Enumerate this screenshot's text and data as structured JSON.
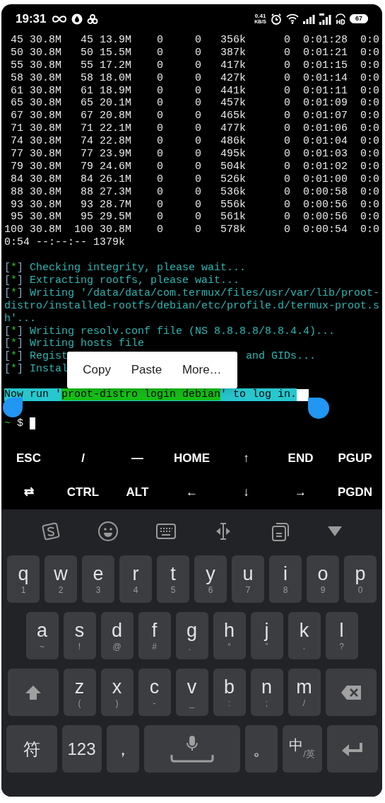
{
  "status_bar": {
    "time": "19:31",
    "net_speed": "0.41",
    "net_speed_unit": "KB/S",
    "battery": "67"
  },
  "terminal": {
    "progress_lines": [
      " 45 30.8M   45 13.9M    0     0   356k      0  0:01:28  0:0",
      " 50 30.8M   50 15.5M    0     0   387k      0  0:01:21  0:0",
      " 55 30.8M   55 17.2M    0     0   417k      0  0:01:15  0:0",
      " 58 30.8M   58 18.0M    0     0   427k      0  0:01:14  0:0",
      " 61 30.8M   61 18.9M    0     0   441k      0  0:01:11  0:0",
      " 65 30.8M   65 20.1M    0     0   457k      0  0:01:09  0:0",
      " 67 30.8M   67 20.8M    0     0   465k      0  0:01:07  0:0",
      " 71 30.8M   71 22.1M    0     0   477k      0  0:01:06  0:0",
      " 74 30.8M   74 22.8M    0     0   486k      0  0:01:04  0:0",
      " 77 30.8M   77 23.9M    0     0   495k      0  0:01:03  0:0",
      " 79 30.8M   79 24.6M    0     0   504k      0  0:01:02  0:0",
      " 84 30.8M   84 26.1M    0     0   526k      0  0:01:00  0:0",
      " 88 30.8M   88 27.3M    0     0   536k      0  0:00:58  0:0",
      " 93 30.8M   93 28.7M    0     0   556k      0  0:00:56  0:0",
      " 95 30.8M   95 29.5M    0     0   561k      0  0:00:56  0:0",
      "100 30.8M  100 30.8M    0     0   578k      0  0:00:54  0:0"
    ],
    "summary_line": "0:54 --:--:-- 1379k",
    "messages": [
      {
        "marker": {
          "open": "[",
          "star": "*",
          "close": "]"
        },
        "parts": [
          "Checking integrity, please wait..."
        ]
      },
      {
        "marker": {
          "open": "[",
          "star": "*",
          "close": "]"
        },
        "parts": [
          "Extracting rootfs, please wait..."
        ]
      },
      {
        "marker": {
          "open": "[",
          "star": "*",
          "close": "]"
        },
        "parts": [
          "Writing '/data/data/com.termux/files/usr/var/lib/proot-distro/installed-rootfs/debian/etc/profile.d/termux-proot.sh'..."
        ]
      },
      {
        "marker": {
          "open": "[",
          "star": "*",
          "close": "]"
        },
        "parts": [
          "Writing resolv.conf file (NS 8.8.8.8/8.8.4.4)..."
        ]
      },
      {
        "marker": {
          "open": "[",
          "star": "*",
          "close": "]"
        },
        "parts": [
          "Writing hosts file"
        ]
      },
      {
        "marker": {
          "open": "[",
          "star": "*",
          "close": "]"
        },
        "parts": [
          "Regist",
          "and GIDs..."
        ]
      },
      {
        "marker": {
          "open": "[",
          "star": "*",
          "close": "]"
        },
        "parts": [
          "Instal"
        ]
      }
    ],
    "selected_line": {
      "before": "Now run '",
      "command": "proot-distro login debian",
      "after": "' to log in."
    },
    "prompt": {
      "dir": "~",
      "sign": "$"
    }
  },
  "context_menu": [
    "Copy",
    "Paste",
    "More…"
  ],
  "extra_keys": [
    [
      "ESC",
      "/",
      "—",
      "HOME",
      "↑",
      "END",
      "PGUP"
    ],
    [
      "⇄",
      "CTRL",
      "ALT",
      "←",
      "↓",
      "→",
      "PGDN"
    ]
  ],
  "keyboard": {
    "letter_rows": [
      [
        {
          "kind": "letter",
          "main": "q",
          "sub": "1"
        },
        {
          "kind": "letter",
          "main": "w",
          "sub": "2"
        },
        {
          "kind": "letter",
          "main": "e",
          "sub": "3"
        },
        {
          "kind": "letter",
          "main": "r",
          "sub": "4"
        },
        {
          "kind": "letter",
          "main": "t",
          "sub": "5"
        },
        {
          "kind": "letter",
          "main": "y",
          "sub": "6"
        },
        {
          "kind": "letter",
          "main": "u",
          "sub": "7"
        },
        {
          "kind": "letter",
          "main": "i",
          "sub": "8"
        },
        {
          "kind": "letter",
          "main": "o",
          "sub": "9"
        },
        {
          "kind": "letter",
          "main": "p",
          "sub": "0"
        }
      ],
      [
        {
          "kind": "letter",
          "main": "a",
          "sub": "~"
        },
        {
          "kind": "letter",
          "main": "s",
          "sub": "!"
        },
        {
          "kind": "letter",
          "main": "d",
          "sub": "@"
        },
        {
          "kind": "letter",
          "main": "f",
          "sub": "#"
        },
        {
          "kind": "letter",
          "main": "g",
          "sub": "、"
        },
        {
          "kind": "letter",
          "main": "h",
          "sub": "“"
        },
        {
          "kind": "letter",
          "main": "j",
          "sub": "”"
        },
        {
          "kind": "letter",
          "main": "k",
          "sub": "."
        },
        {
          "kind": "letter",
          "main": "l",
          "sub": "?"
        }
      ],
      [
        {
          "kind": "shift"
        },
        {
          "kind": "letter",
          "main": "z",
          "sub": "("
        },
        {
          "kind": "letter",
          "main": "x",
          "sub": ")"
        },
        {
          "kind": "letter",
          "main": "c",
          "sub": "-"
        },
        {
          "kind": "letter",
          "main": "v",
          "sub": "_"
        },
        {
          "kind": "letter",
          "main": "b",
          "sub": ":"
        },
        {
          "kind": "letter",
          "main": "n",
          "sub": ";"
        },
        {
          "kind": "letter",
          "main": "m",
          "sub": "/"
        },
        {
          "kind": "backspace"
        }
      ]
    ],
    "bottom_row": [
      {
        "kind": "label",
        "main": "符"
      },
      {
        "kind": "label",
        "main": "123"
      },
      {
        "kind": "label",
        "main": "，"
      },
      {
        "kind": "space"
      },
      {
        "kind": "label",
        "main": "。"
      },
      {
        "kind": "lang",
        "main": "中",
        "sub": "/英"
      },
      {
        "kind": "enter"
      }
    ]
  }
}
